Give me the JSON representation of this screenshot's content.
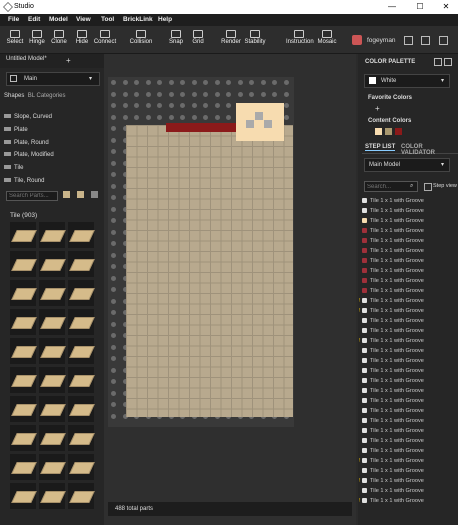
{
  "window": {
    "title": "Studio",
    "minimize": "—",
    "maximize": "☐",
    "close": "✕"
  },
  "menu": [
    "File",
    "Edit",
    "Model",
    "View",
    "Tool",
    "BrickLink",
    "Help"
  ],
  "toolbar": [
    "Select",
    "Hinge",
    "Clone",
    "Hide",
    "Connect",
    "Collision",
    "Snap",
    "Grid",
    "Render",
    "Stability",
    "Instruction",
    "Mosaic"
  ],
  "user": {
    "name": "fogeyman"
  },
  "doc_tab": "Untitled Model*",
  "model_select": "Main",
  "shapes": {
    "header": "Shapes",
    "header2": "BL Categories",
    "items": [
      "Slope, Curved",
      "Plate",
      "Plate, Round",
      "Plate, Modified",
      "Tile",
      "Tile, Round"
    ]
  },
  "search_parts_placeholder": "Search Parts...",
  "tile_count_label": "Tile (903)",
  "status_text": "488 total parts",
  "color_palette": {
    "header": "COLOR PALETTE",
    "selected": "White",
    "favorite": "Favorite Colors",
    "content": "Content Colors",
    "content_colors": [
      "#f7dcb0",
      "#a9986f",
      "#8b1a1a"
    ]
  },
  "tabs": {
    "step_list": "STEP LIST",
    "color_validator": "COLOR VALIDATOR"
  },
  "step_model": "Main Model",
  "step_search_placeholder": "Search...",
  "step_view_label": "Step view",
  "step_items": [
    {
      "label": "Tile 1 x 1 with Groove",
      "warn": false,
      "color": "#e0e0e0"
    },
    {
      "label": "Tile 1 x 1 with Groove",
      "warn": false,
      "color": "#e0e0e0"
    },
    {
      "label": "Tile 1 x 1 with Groove",
      "warn": false,
      "color": "#f7dcb0"
    },
    {
      "label": "Tile 1 x 1 with Groove",
      "warn": false,
      "color": "#a0303a"
    },
    {
      "label": "Tile 1 x 1 with Groove",
      "warn": false,
      "color": "#a0303a"
    },
    {
      "label": "Tile 1 x 1 with Groove",
      "warn": false,
      "color": "#a0303a"
    },
    {
      "label": "Tile 1 x 1 with Groove",
      "warn": false,
      "color": "#a0303a"
    },
    {
      "label": "Tile 1 x 1 with Groove",
      "warn": false,
      "color": "#a0303a"
    },
    {
      "label": "Tile 1 x 1 with Groove",
      "warn": false,
      "color": "#a0303a"
    },
    {
      "label": "Tile 1 x 1 with Groove",
      "warn": false,
      "color": "#a0303a"
    },
    {
      "label": "Tile 1 x 1 with Groove",
      "warn": true,
      "color": "#e0e0e0"
    },
    {
      "label": "Tile 1 x 1 with Groove",
      "warn": true,
      "color": "#e0e0e0"
    },
    {
      "label": "Tile 1 x 1 with Groove",
      "warn": false,
      "color": "#e0e0e0"
    },
    {
      "label": "Tile 1 x 1 with Groove",
      "warn": false,
      "color": "#e0e0e0"
    },
    {
      "label": "Tile 1 x 1 with Groove",
      "warn": true,
      "color": "#e0e0e0"
    },
    {
      "label": "Tile 1 x 1 with Groove",
      "warn": false,
      "color": "#e0e0e0"
    },
    {
      "label": "Tile 1 x 1 with Groove",
      "warn": false,
      "color": "#e0e0e0"
    },
    {
      "label": "Tile 1 x 1 with Groove",
      "warn": false,
      "color": "#e0e0e0"
    },
    {
      "label": "Tile 1 x 1 with Groove",
      "warn": false,
      "color": "#e0e0e0"
    },
    {
      "label": "Tile 1 x 1 with Groove",
      "warn": false,
      "color": "#e0e0e0"
    },
    {
      "label": "Tile 1 x 1 with Groove",
      "warn": false,
      "color": "#e0e0e0"
    },
    {
      "label": "Tile 1 x 1 with Groove",
      "warn": false,
      "color": "#e0e0e0"
    },
    {
      "label": "Tile 1 x 1 with Groove",
      "warn": false,
      "color": "#e0e0e0"
    },
    {
      "label": "Tile 1 x 1 with Groove",
      "warn": false,
      "color": "#e0e0e0"
    },
    {
      "label": "Tile 1 x 1 with Groove",
      "warn": false,
      "color": "#e0e0e0"
    },
    {
      "label": "Tile 1 x 1 with Groove",
      "warn": false,
      "color": "#e0e0e0"
    },
    {
      "label": "Tile 1 x 1 with Groove",
      "warn": true,
      "color": "#e0e0e0"
    },
    {
      "label": "Tile 1 x 1 with Groove",
      "warn": false,
      "color": "#e0e0e0"
    },
    {
      "label": "Tile 1 x 1 with Groove",
      "warn": true,
      "color": "#e0e0e0"
    },
    {
      "label": "Tile 1 x 1 with Groove",
      "warn": false,
      "color": "#e0e0e0"
    },
    {
      "label": "Tile 1 x 1 with Groove",
      "warn": true,
      "color": "#e0e0e0"
    }
  ]
}
